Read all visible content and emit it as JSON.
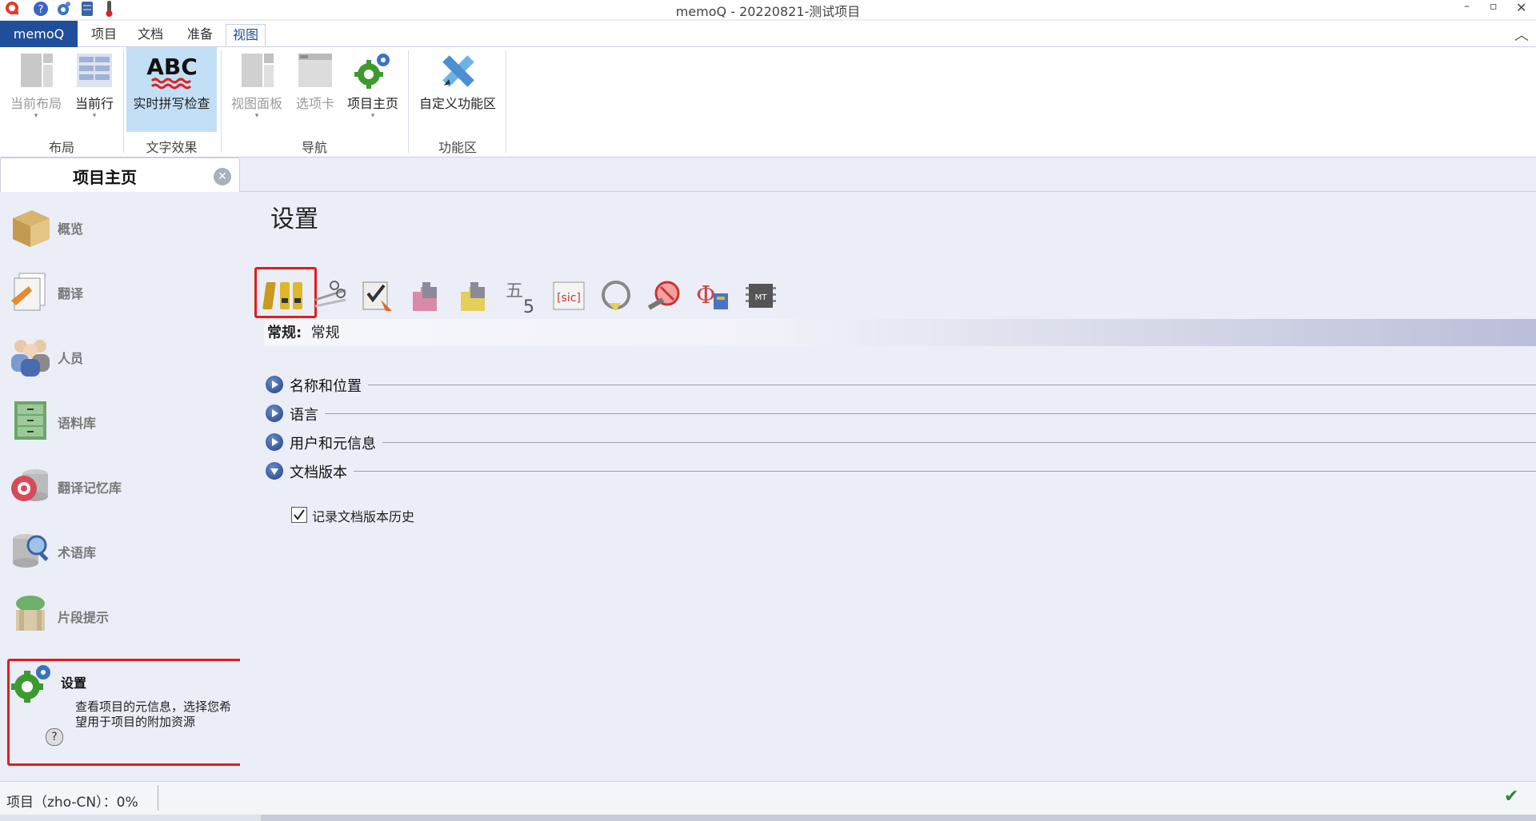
{
  "window": {
    "title": "memoQ - 20220821-测试项目",
    "minimize": "–",
    "restore": "▫",
    "collapse_ribbon": "︿"
  },
  "menu": {
    "tabs": [
      "memoQ",
      "项目",
      "文档",
      "准备",
      "视图"
    ],
    "active": "视图"
  },
  "ribbon": {
    "buttons": {
      "current_layout": "当前布局",
      "current_row": "当前行",
      "spell_check": "实时拼写检查",
      "view_pane": "视图面板",
      "tab_card": "选项卡",
      "project_home": "项目主页",
      "customize_ribbon": "自定义功能区"
    },
    "groups": {
      "layout": "布局",
      "text_effects": "文字效果",
      "navigation": "导航",
      "ribbon_area": "功能区"
    },
    "abc_text": "ABC"
  },
  "left_panel": {
    "title": "项目主页",
    "items": [
      {
        "label": "概览",
        "icon": "box-icon"
      },
      {
        "label": "翻译",
        "icon": "documents-icon"
      },
      {
        "label": "人员",
        "icon": "people-icon"
      },
      {
        "label": "语料库",
        "icon": "cabinet-icon"
      },
      {
        "label": "翻译记忆库",
        "icon": "tm-database-icon"
      },
      {
        "label": "术语库",
        "icon": "termbase-icon"
      },
      {
        "label": "片段提示",
        "icon": "muse-icon"
      },
      {
        "label": "设置",
        "icon": "gear-icon"
      }
    ],
    "selected": "设置",
    "settings_description": "查看项目的元信息，选择您希望用于项目的附加资源",
    "help": "?"
  },
  "content": {
    "title": "设置",
    "section_label_bold": "常规:",
    "section_label": "常规",
    "accordions": [
      {
        "title": "名称和位置",
        "expanded": false
      },
      {
        "title": "语言",
        "expanded": false
      },
      {
        "title": "用户和元信息",
        "expanded": false
      },
      {
        "title": "文档版本",
        "expanded": true
      }
    ],
    "checkbox_label": "记录文档版本历史",
    "checkbox_checked": true,
    "toolbar_icons": [
      "general-settings-icon",
      "segmentation-icon",
      "qa-settings-icon",
      "autotranslation-icon",
      "autocorrect-icon",
      "font-substitution-icon",
      "nontranslatables-icon",
      "autocorrect-list-icon",
      "ignore-list-icon",
      "keyboard-shortcuts-icon",
      "mt-settings-icon"
    ],
    "mt_label": "MT"
  },
  "status": {
    "text": "项目（zho-CN）：0%",
    "ok": "✔"
  },
  "colors": {
    "brand": "#1f4e9a",
    "highlight_border": "#e51b1b",
    "background": "#ebeef7"
  }
}
